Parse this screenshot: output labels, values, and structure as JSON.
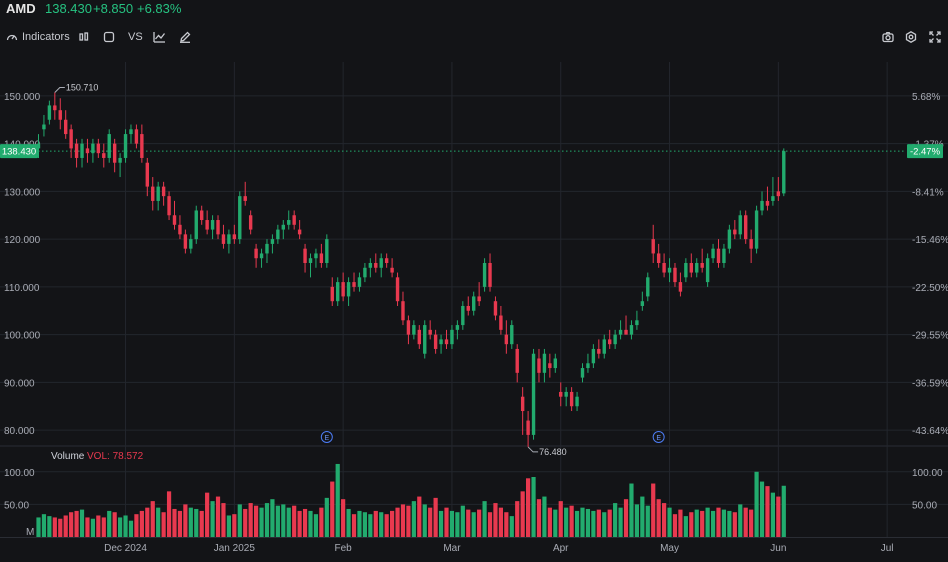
{
  "header": {
    "symbol": "AMD",
    "price": "138.430",
    "change": "+8.850",
    "change_pct": "+6.83%"
  },
  "toolbar": {
    "indicators_label": "Indicators",
    "compare_label": "VS"
  },
  "colors": {
    "up": "#22ab6e",
    "down": "#e8394f",
    "background": "#131417",
    "grid": "#23262d"
  },
  "chart_data": {
    "type": "candlestick",
    "price_axis_ticks": [
      "150.000",
      "140.000",
      "130.000",
      "120.000",
      "110.000",
      "100.000",
      "90.000",
      "80.000"
    ],
    "price_axis_values": [
      150,
      140,
      130,
      120,
      110,
      100,
      90,
      80
    ],
    "percent_axis_ticks": [
      "5.68%",
      "-1.37%",
      "-8.41%",
      "-15.46%",
      "-22.50%",
      "-29.55%",
      "-36.59%",
      "-43.64%"
    ],
    "ylim": [
      75,
      155
    ],
    "x_tick_labels": [
      "Dec 2024",
      "Jan 2025",
      "Feb",
      "Mar",
      "Apr",
      "May",
      "Jun",
      "Jul"
    ],
    "last_price_label": "138.430",
    "last_percent_label": "-2.47%",
    "last_price": 138.43,
    "high_annotation": {
      "label": "150.710",
      "value": 150.71
    },
    "low_annotation": {
      "label": "76.480",
      "value": 76.48
    },
    "earnings_marker": "E",
    "volume": {
      "title": "Volume",
      "value_label": "VOL: 78.572",
      "axis_ticks": [
        "100.00",
        "50.00"
      ],
      "axis_values": [
        100,
        50
      ],
      "unit_label": "M",
      "ylim": [
        0,
        115
      ]
    },
    "candles": [
      {
        "o": 139,
        "h": 142,
        "l": 137,
        "c": 140,
        "v": 30
      },
      {
        "o": 143,
        "h": 146,
        "l": 141.5,
        "c": 144,
        "v": 35
      },
      {
        "o": 145,
        "h": 149,
        "l": 144,
        "c": 148,
        "v": 32
      },
      {
        "o": 148,
        "h": 150.71,
        "l": 145,
        "c": 147,
        "v": 30
      },
      {
        "o": 147,
        "h": 149.5,
        "l": 143,
        "c": 145,
        "v": 28
      },
      {
        "o": 145,
        "h": 147,
        "l": 141,
        "c": 142,
        "v": 33
      },
      {
        "o": 143,
        "h": 144,
        "l": 137,
        "c": 139,
        "v": 38
      },
      {
        "o": 140,
        "h": 141,
        "l": 135,
        "c": 137,
        "v": 40
      },
      {
        "o": 137,
        "h": 141,
        "l": 135,
        "c": 140,
        "v": 42
      },
      {
        "o": 139,
        "h": 141,
        "l": 136,
        "c": 138,
        "v": 30
      },
      {
        "o": 138,
        "h": 141,
        "l": 136,
        "c": 140,
        "v": 28
      },
      {
        "o": 140,
        "h": 141,
        "l": 137,
        "c": 138,
        "v": 33
      },
      {
        "o": 138,
        "h": 140,
        "l": 135,
        "c": 137,
        "v": 30
      },
      {
        "o": 137,
        "h": 143,
        "l": 136,
        "c": 142,
        "v": 40
      },
      {
        "o": 140,
        "h": 141,
        "l": 134,
        "c": 136,
        "v": 38
      },
      {
        "o": 136,
        "h": 138,
        "l": 133,
        "c": 137,
        "v": 30
      },
      {
        "o": 137,
        "h": 143,
        "l": 136,
        "c": 142,
        "v": 33
      },
      {
        "o": 142,
        "h": 144,
        "l": 140,
        "c": 143,
        "v": 25
      },
      {
        "o": 143,
        "h": 144,
        "l": 139,
        "c": 140,
        "v": 35
      },
      {
        "o": 142,
        "h": 144,
        "l": 136,
        "c": 137,
        "v": 40
      },
      {
        "o": 136,
        "h": 137,
        "l": 129,
        "c": 131,
        "v": 45
      },
      {
        "o": 131,
        "h": 133,
        "l": 126,
        "c": 128,
        "v": 55
      },
      {
        "o": 128,
        "h": 132,
        "l": 126,
        "c": 131,
        "v": 45
      },
      {
        "o": 131,
        "h": 132,
        "l": 127,
        "c": 129,
        "v": 38
      },
      {
        "o": 129,
        "h": 130,
        "l": 124,
        "c": 125,
        "v": 70
      },
      {
        "o": 125,
        "h": 128,
        "l": 122,
        "c": 123,
        "v": 43
      },
      {
        "o": 123,
        "h": 125,
        "l": 120,
        "c": 121,
        "v": 40
      },
      {
        "o": 121,
        "h": 122,
        "l": 117,
        "c": 118,
        "v": 50
      },
      {
        "o": 118,
        "h": 121,
        "l": 117,
        "c": 120,
        "v": 45
      },
      {
        "o": 120,
        "h": 127,
        "l": 119,
        "c": 126,
        "v": 43
      },
      {
        "o": 126,
        "h": 127,
        "l": 123,
        "c": 124,
        "v": 40
      },
      {
        "o": 124,
        "h": 126,
        "l": 121,
        "c": 122,
        "v": 68
      },
      {
        "o": 122,
        "h": 125,
        "l": 120,
        "c": 124,
        "v": 55
      },
      {
        "o": 124,
        "h": 125,
        "l": 120,
        "c": 121,
        "v": 62
      },
      {
        "o": 121,
        "h": 123,
        "l": 118,
        "c": 119,
        "v": 52
      },
      {
        "o": 119,
        "h": 122,
        "l": 117,
        "c": 121,
        "v": 33
      },
      {
        "o": 121,
        "h": 123,
        "l": 119,
        "c": 120,
        "v": 35
      },
      {
        "o": 120,
        "h": 130,
        "l": 119,
        "c": 129,
        "v": 50
      },
      {
        "o": 129,
        "h": 132,
        "l": 127,
        "c": 128,
        "v": 43
      },
      {
        "o": 125,
        "h": 126,
        "l": 121,
        "c": 122,
        "v": 52
      },
      {
        "o": 118,
        "h": 119,
        "l": 114,
        "c": 116,
        "v": 48
      },
      {
        "o": 116,
        "h": 118,
        "l": 114,
        "c": 117,
        "v": 45
      },
      {
        "o": 117,
        "h": 120,
        "l": 115,
        "c": 119,
        "v": 52
      },
      {
        "o": 119,
        "h": 121,
        "l": 117,
        "c": 120,
        "v": 58
      },
      {
        "o": 120,
        "h": 123,
        "l": 119,
        "c": 122,
        "v": 48
      },
      {
        "o": 122,
        "h": 124,
        "l": 120,
        "c": 123,
        "v": 50
      },
      {
        "o": 123,
        "h": 126,
        "l": 122,
        "c": 124,
        "v": 45
      },
      {
        "o": 125,
        "h": 126,
        "l": 122,
        "c": 123,
        "v": 48
      },
      {
        "o": 122,
        "h": 124,
        "l": 120,
        "c": 121,
        "v": 40
      },
      {
        "o": 118,
        "h": 119,
        "l": 113,
        "c": 115,
        "v": 43
      },
      {
        "o": 115,
        "h": 117,
        "l": 112,
        "c": 116,
        "v": 40
      },
      {
        "o": 116,
        "h": 118,
        "l": 114,
        "c": 117,
        "v": 35
      },
      {
        "o": 117,
        "h": 119,
        "l": 114,
        "c": 115,
        "v": 45
      },
      {
        "o": 115,
        "h": 121,
        "l": 114,
        "c": 120,
        "v": 60
      },
      {
        "o": 110,
        "h": 112,
        "l": 106,
        "c": 107,
        "v": 85
      },
      {
        "o": 107,
        "h": 112,
        "l": 106,
        "c": 111,
        "v": 112
      },
      {
        "o": 111,
        "h": 113,
        "l": 107,
        "c": 108,
        "v": 58
      },
      {
        "o": 108,
        "h": 112,
        "l": 106,
        "c": 111,
        "v": 43
      },
      {
        "o": 111,
        "h": 113,
        "l": 109,
        "c": 110,
        "v": 35
      },
      {
        "o": 110,
        "h": 113,
        "l": 109,
        "c": 112,
        "v": 40
      },
      {
        "o": 112,
        "h": 115,
        "l": 111,
        "c": 114,
        "v": 38
      },
      {
        "o": 114,
        "h": 116,
        "l": 112,
        "c": 115,
        "v": 35
      },
      {
        "o": 115,
        "h": 117,
        "l": 113,
        "c": 114,
        "v": 40
      },
      {
        "o": 114,
        "h": 117,
        "l": 112,
        "c": 116,
        "v": 38
      },
      {
        "o": 116,
        "h": 117,
        "l": 114,
        "c": 115,
        "v": 35
      },
      {
        "o": 114,
        "h": 116,
        "l": 112,
        "c": 113,
        "v": 40
      },
      {
        "o": 112,
        "h": 113,
        "l": 106,
        "c": 107,
        "v": 45
      },
      {
        "o": 107,
        "h": 109,
        "l": 102,
        "c": 103,
        "v": 50
      },
      {
        "o": 103,
        "h": 104,
        "l": 98,
        "c": 100,
        "v": 48
      },
      {
        "o": 100,
        "h": 103,
        "l": 99,
        "c": 102,
        "v": 55
      },
      {
        "o": 101,
        "h": 102,
        "l": 97,
        "c": 98,
        "v": 62
      },
      {
        "o": 96,
        "h": 103,
        "l": 95,
        "c": 102,
        "v": 50
      },
      {
        "o": 101,
        "h": 103,
        "l": 99,
        "c": 100,
        "v": 45
      },
      {
        "o": 100,
        "h": 101,
        "l": 96,
        "c": 97,
        "v": 60
      },
      {
        "o": 98,
        "h": 100,
        "l": 96,
        "c": 99,
        "v": 40
      },
      {
        "o": 99,
        "h": 101,
        "l": 97,
        "c": 98,
        "v": 45
      },
      {
        "o": 98,
        "h": 102,
        "l": 97,
        "c": 101,
        "v": 40
      },
      {
        "o": 101,
        "h": 103,
        "l": 99,
        "c": 102,
        "v": 38
      },
      {
        "o": 102,
        "h": 107,
        "l": 101,
        "c": 106,
        "v": 48
      },
      {
        "o": 106,
        "h": 108,
        "l": 104,
        "c": 105,
        "v": 42
      },
      {
        "o": 105,
        "h": 109,
        "l": 104,
        "c": 108,
        "v": 38
      },
      {
        "o": 108,
        "h": 111,
        "l": 106,
        "c": 107,
        "v": 42
      },
      {
        "o": 110,
        "h": 116,
        "l": 109,
        "c": 115,
        "v": 55
      },
      {
        "o": 115,
        "h": 117,
        "l": 109,
        "c": 110,
        "v": 38
      },
      {
        "o": 107,
        "h": 108,
        "l": 103,
        "c": 104,
        "v": 52
      },
      {
        "o": 104,
        "h": 106,
        "l": 100,
        "c": 101,
        "v": 45
      },
      {
        "o": 100,
        "h": 103,
        "l": 96,
        "c": 98,
        "v": 38
      },
      {
        "o": 98,
        "h": 103,
        "l": 97,
        "c": 102,
        "v": 32
      },
      {
        "o": 97,
        "h": 98,
        "l": 90,
        "c": 92,
        "v": 55
      },
      {
        "o": 87,
        "h": 89,
        "l": 79,
        "c": 84,
        "v": 70
      },
      {
        "o": 82,
        "h": 84,
        "l": 76.48,
        "c": 79,
        "v": 90
      },
      {
        "o": 79,
        "h": 97,
        "l": 78,
        "c": 96,
        "v": 92
      },
      {
        "o": 95,
        "h": 97,
        "l": 90,
        "c": 92,
        "v": 58
      },
      {
        "o": 92,
        "h": 97,
        "l": 90,
        "c": 96,
        "v": 62
      },
      {
        "o": 94,
        "h": 96,
        "l": 91,
        "c": 93,
        "v": 45
      },
      {
        "o": 93,
        "h": 96,
        "l": 92,
        "c": 95,
        "v": 42
      },
      {
        "o": 88,
        "h": 90,
        "l": 85,
        "c": 87,
        "v": 55
      },
      {
        "o": 87,
        "h": 89,
        "l": 85,
        "c": 88,
        "v": 45
      },
      {
        "o": 88,
        "h": 89,
        "l": 84,
        "c": 85,
        "v": 48
      },
      {
        "o": 85,
        "h": 88,
        "l": 84,
        "c": 87,
        "v": 40
      },
      {
        "o": 91,
        "h": 94,
        "l": 90,
        "c": 93,
        "v": 45
      },
      {
        "o": 93,
        "h": 96,
        "l": 92,
        "c": 94,
        "v": 43
      },
      {
        "o": 94,
        "h": 98,
        "l": 93,
        "c": 97,
        "v": 40
      },
      {
        "o": 97,
        "h": 99,
        "l": 95,
        "c": 96,
        "v": 42
      },
      {
        "o": 96,
        "h": 100,
        "l": 95,
        "c": 99,
        "v": 38
      },
      {
        "o": 99,
        "h": 101,
        "l": 97,
        "c": 98,
        "v": 42
      },
      {
        "o": 98,
        "h": 101,
        "l": 97,
        "c": 100,
        "v": 52
      },
      {
        "o": 100,
        "h": 103,
        "l": 99,
        "c": 101,
        "v": 45
      },
      {
        "o": 101,
        "h": 104,
        "l": 100,
        "c": 100,
        "v": 58
      },
      {
        "o": 100,
        "h": 103,
        "l": 99,
        "c": 102,
        "v": 82
      },
      {
        "o": 102,
        "h": 105,
        "l": 101,
        "c": 103,
        "v": 50
      },
      {
        "o": 106,
        "h": 109,
        "l": 105,
        "c": 107,
        "v": 62
      },
      {
        "o": 108,
        "h": 113,
        "l": 107,
        "c": 112,
        "v": 48
      },
      {
        "o": 120,
        "h": 123,
        "l": 115,
        "c": 117,
        "v": 82
      },
      {
        "o": 117,
        "h": 119,
        "l": 114,
        "c": 115,
        "v": 58
      },
      {
        "o": 115,
        "h": 117,
        "l": 112,
        "c": 113,
        "v": 52
      },
      {
        "o": 113,
        "h": 116,
        "l": 111,
        "c": 114,
        "v": 45
      },
      {
        "o": 114,
        "h": 115,
        "l": 110,
        "c": 111,
        "v": 35
      },
      {
        "o": 111,
        "h": 113,
        "l": 108,
        "c": 109,
        "v": 42
      },
      {
        "o": 112,
        "h": 116,
        "l": 111,
        "c": 115,
        "v": 32
      },
      {
        "o": 115,
        "h": 117,
        "l": 112,
        "c": 113,
        "v": 38
      },
      {
        "o": 113,
        "h": 116,
        "l": 112,
        "c": 115,
        "v": 42
      },
      {
        "o": 115,
        "h": 118,
        "l": 113,
        "c": 114,
        "v": 40
      },
      {
        "o": 111,
        "h": 117,
        "l": 110,
        "c": 116,
        "v": 45
      },
      {
        "o": 116,
        "h": 119,
        "l": 115,
        "c": 118,
        "v": 40
      },
      {
        "o": 118,
        "h": 120,
        "l": 114,
        "c": 115,
        "v": 45
      },
      {
        "o": 115,
        "h": 119,
        "l": 114,
        "c": 118,
        "v": 42
      },
      {
        "o": 118,
        "h": 123,
        "l": 117,
        "c": 122,
        "v": 40
      },
      {
        "o": 122,
        "h": 124,
        "l": 120,
        "c": 121,
        "v": 38
      },
      {
        "o": 121,
        "h": 126,
        "l": 120,
        "c": 125,
        "v": 50
      },
      {
        "o": 125,
        "h": 126,
        "l": 119,
        "c": 120,
        "v": 45
      },
      {
        "o": 120,
        "h": 122,
        "l": 115,
        "c": 118,
        "v": 42
      },
      {
        "o": 118,
        "h": 127,
        "l": 117,
        "c": 126,
        "v": 100
      },
      {
        "o": 126,
        "h": 130,
        "l": 125,
        "c": 128,
        "v": 85
      },
      {
        "o": 128,
        "h": 131,
        "l": 126,
        "c": 127,
        "v": 78
      },
      {
        "o": 128,
        "h": 133,
        "l": 127,
        "c": 129,
        "v": 68
      },
      {
        "o": 130,
        "h": 133,
        "l": 128,
        "c": 129,
        "v": 62
      },
      {
        "o": 129.58,
        "h": 139,
        "l": 129,
        "c": 138.43,
        "v": 78.572
      }
    ],
    "earnings_candle_indexes": [
      53,
      114
    ],
    "x_tick_candle_indexes": [
      16,
      36,
      56,
      76,
      96,
      116,
      136,
      156
    ]
  }
}
